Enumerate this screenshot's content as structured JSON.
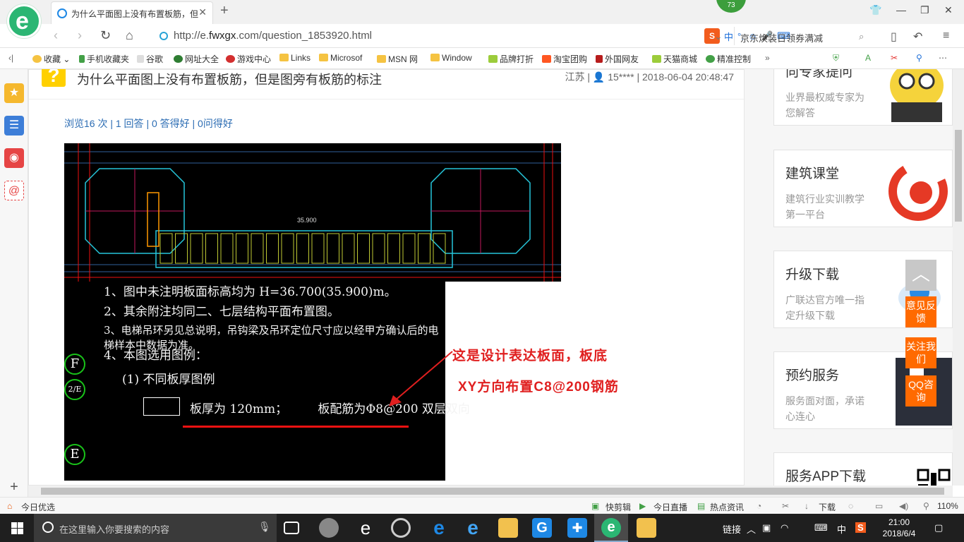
{
  "browser": {
    "tab_title": "为什么平面图上没有布置板筋，但是图旁有板筋的标注",
    "notification_count": "73",
    "url_prefix": "http://e.",
    "url_domain": "fwxgx",
    "url_suffix": ".com/question_1853920.html",
    "ime_items": [
      "S",
      "中",
      "°,",
      "☺",
      "🎤",
      "⌨"
    ],
    "search_text": "京东焕装日领券满减"
  },
  "bookmarks": [
    {
      "label": "收藏",
      "icon": "star-icon"
    },
    {
      "label": "手机收藏夹",
      "icon": "phone-icon"
    },
    {
      "label": "谷歌",
      "icon": "page-icon"
    },
    {
      "label": "网址大全",
      "icon": "globe-icon"
    },
    {
      "label": "游戏中心",
      "icon": "game-icon"
    },
    {
      "label": "Links",
      "icon": "folder-icon"
    },
    {
      "label": "Microsof",
      "icon": "folder-icon"
    },
    {
      "label": "MSN 网",
      "icon": "folder-icon"
    },
    {
      "label": "Window",
      "icon": "folder-icon"
    },
    {
      "label": "品牌打折",
      "icon": "leaf-icon"
    },
    {
      "label": "淘宝团购",
      "icon": "taobao-icon"
    },
    {
      "label": "外国网友",
      "icon": "flag-icon"
    },
    {
      "label": "天猫商城",
      "icon": "leaf-icon"
    },
    {
      "label": "精准控制",
      "icon": "chat-icon"
    }
  ],
  "question": {
    "title": "为什么平面图上没有布置板筋，但是图旁有板筋的标注",
    "meta": "江苏 | 👤 15**** | 2018-06-04 20:48:47",
    "stats": "浏览16 次 | 1 回答 | 0 答得好 | 0问得好",
    "drawing_elevation": "35.900",
    "notes": [
      "1、图中未注明板面标高均为 H=36.700(35.900)m。",
      "2、其余附注均同二、七层结构平面布置图。",
      "3、电梯吊环另见总说明，吊钩梁及吊环定位尺寸应以经甲方确认后的电梯样本中数据为准。",
      "4、本图选用图例：",
      "(1) 不同板厚图例",
      "板厚为 120mm；        板配筋为Φ8@200 双层双向"
    ],
    "grid_labels": [
      "F",
      "2/E",
      "E"
    ],
    "annotation_line1": "这是设计表达板面，板底",
    "annotation_line2": "XY方向布置C8@200钢筋"
  },
  "sidebar": {
    "ads": [
      {
        "heading": "向专家提问",
        "desc": "业界最权威专家为您解答"
      },
      {
        "heading": "建筑课堂",
        "desc": "建筑行业实训教学第一平台"
      },
      {
        "heading": "升级下载",
        "desc": "广联达官方唯一指定升级下载"
      },
      {
        "heading": "预约服务",
        "desc": "服务面对面，承诺心连心"
      },
      {
        "heading": "服务APP下载",
        "desc": ""
      }
    ],
    "float_buttons": [
      "意见反馈",
      "关注我们",
      "QQ咨询"
    ]
  },
  "statusbar": {
    "left": "今日优选",
    "items": [
      "快剪辑",
      "今日直播",
      "热点资讯",
      "下载"
    ],
    "zoom": "110%"
  },
  "taskbar": {
    "search_placeholder": "在这里输入你要搜索的内容",
    "tray_link": "链接",
    "ime": "中",
    "time": "21:00",
    "date": "2018/6/4"
  }
}
